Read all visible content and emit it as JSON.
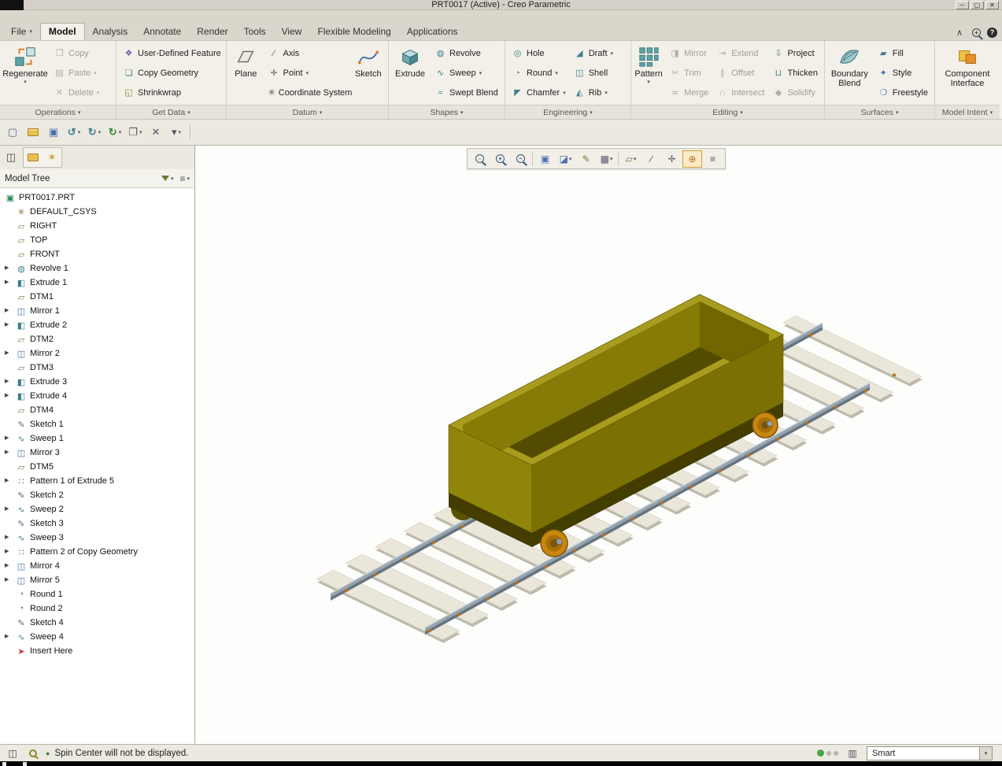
{
  "window": {
    "title": "PRT0017 (Active) - Creo Parametric",
    "buttons": {
      "minimize": "─",
      "maximize": "▢",
      "close": "✕"
    }
  },
  "tabs": {
    "items": [
      {
        "label": "File",
        "dropdown": true
      },
      {
        "label": "Model",
        "state": "active"
      },
      {
        "label": "Analysis"
      },
      {
        "label": "Annotate"
      },
      {
        "label": "Render"
      },
      {
        "label": "Tools"
      },
      {
        "label": "View"
      },
      {
        "label": "Flexible Modeling"
      },
      {
        "label": "Applications"
      }
    ],
    "right_icons": [
      {
        "icon": "minimize-ribbon"
      },
      {
        "icon": "search"
      },
      {
        "icon": "help"
      }
    ]
  },
  "ribbon": {
    "groups": [
      {
        "label": "Operations",
        "big": {
          "label": "Regenerate",
          "icon": "regenerate",
          "dropdown": true
        },
        "items": [
          {
            "label": "Copy",
            "icon": "copy",
            "disabled": true
          },
          {
            "label": "Paste",
            "icon": "paste",
            "disabled": true,
            "dropdown": true
          },
          {
            "label": "Delete",
            "icon": "delete",
            "disabled": true,
            "dropdown": true
          }
        ]
      },
      {
        "label": "Get Data",
        "items": [
          {
            "label": "User-Defined Feature",
            "icon": "udf"
          },
          {
            "label": "Copy Geometry",
            "icon": "copy-geometry"
          },
          {
            "label": "Shrinkwrap",
            "icon": "shrinkwrap"
          }
        ]
      },
      {
        "label": "Datum",
        "big": {
          "label": "Plane",
          "icon": "plane"
        },
        "big2": {
          "label": "Sketch",
          "icon": "sketch"
        },
        "items": [
          {
            "label": "Axis",
            "icon": "axis"
          },
          {
            "label": "Point",
            "icon": "point",
            "dropdown": true
          },
          {
            "label": "Coordinate System",
            "icon": "csys"
          }
        ]
      },
      {
        "label": "Shapes",
        "big": {
          "label": "Extrude",
          "icon": "extrude"
        },
        "items": [
          {
            "label": "Revolve",
            "icon": "revolve"
          },
          {
            "label": "Sweep",
            "icon": "sweep",
            "dropdown": true
          },
          {
            "label": "Swept Blend",
            "icon": "swept-blend"
          }
        ]
      },
      {
        "label": "Engineering",
        "items": [
          {
            "label": "Hole",
            "icon": "hole"
          },
          {
            "label": "Round",
            "icon": "round",
            "dropdown": true
          },
          {
            "label": "Chamfer",
            "icon": "chamfer",
            "dropdown": true
          },
          {
            "label": "Draft",
            "icon": "draft",
            "dropdown": true
          },
          {
            "label": "Shell",
            "icon": "shell"
          },
          {
            "label": "Rib",
            "icon": "rib",
            "dropdown": true
          }
        ]
      },
      {
        "label": "Editing",
        "big": {
          "label": "Pattern",
          "icon": "pattern",
          "dropdown": true
        },
        "items": [
          {
            "label": "Mirror",
            "icon": "mirror",
            "disabled": true
          },
          {
            "label": "Trim",
            "icon": "trim",
            "disabled": true
          },
          {
            "label": "Merge",
            "icon": "merge",
            "disabled": true
          },
          {
            "label": "Extend",
            "icon": "extend",
            "disabled": true
          },
          {
            "label": "Offset",
            "icon": "offset",
            "disabled": true
          },
          {
            "label": "Intersect",
            "icon": "intersect",
            "disabled": true
          },
          {
            "label": "Project",
            "icon": "project"
          },
          {
            "label": "Thicken",
            "icon": "thicken"
          },
          {
            "label": "Solidify",
            "icon": "solidify",
            "disabled": true
          }
        ]
      },
      {
        "label": "Surfaces",
        "big": {
          "label": "Boundary Blend",
          "icon": "boundary-blend"
        },
        "items": [
          {
            "label": "Fill",
            "icon": "fill"
          },
          {
            "label": "Style",
            "icon": "style"
          },
          {
            "label": "Freestyle",
            "icon": "freestyle"
          }
        ]
      },
      {
        "label": "Model Intent",
        "big": {
          "label": "Component Interface",
          "icon": "component-interface"
        }
      }
    ]
  },
  "quick_toolbar": {
    "items": [
      {
        "icon": "new-file"
      },
      {
        "icon": "open-folder"
      },
      {
        "icon": "save"
      },
      {
        "icon": "undo",
        "dropdown": true
      },
      {
        "icon": "redo",
        "dropdown": true
      },
      {
        "icon": "regenerate-small",
        "dropdown": true
      },
      {
        "icon": "window",
        "dropdown": true
      },
      {
        "icon": "close-window"
      },
      {
        "icon": "customize-toolbar",
        "dropdown": true
      }
    ]
  },
  "navigator_toolbar": {
    "items": [
      {
        "icon": "show-navigator"
      },
      {
        "icon": "folder-browser"
      },
      {
        "icon": "favorites"
      }
    ]
  },
  "graphics_toolbar": {
    "items": [
      {
        "icon": "refit"
      },
      {
        "icon": "zoom-in"
      },
      {
        "icon": "zoom-out",
        "sep": true
      },
      {
        "icon": "repaint"
      },
      {
        "icon": "display-style",
        "dropdown": true
      },
      {
        "icon": "annotation-display"
      },
      {
        "icon": "saved-orientations",
        "dropdown": true,
        "sep": true
      },
      {
        "icon": "datum-display",
        "dropdown": true
      },
      {
        "icon": "axis-display"
      },
      {
        "icon": "point-display"
      },
      {
        "icon": "spin-center",
        "state": "active"
      },
      {
        "icon": "view-manager"
      }
    ]
  },
  "model_tree": {
    "title": "Model Tree",
    "items": [
      {
        "label": "PRT0017.PRT",
        "icon": "part",
        "level": "root"
      },
      {
        "label": "DEFAULT_CSYS",
        "icon": "csys"
      },
      {
        "label": "RIGHT",
        "icon": "plane"
      },
      {
        "label": "TOP",
        "icon": "plane"
      },
      {
        "label": "FRONT",
        "icon": "plane"
      },
      {
        "label": "Revolve 1",
        "icon": "revolve",
        "expand": true
      },
      {
        "label": "Extrude 1",
        "icon": "extrude",
        "expand": true
      },
      {
        "label": "DTM1",
        "icon": "plane"
      },
      {
        "label": "Mirror 1",
        "icon": "mirror",
        "expand": true
      },
      {
        "label": "Extrude 2",
        "icon": "extrude",
        "expand": true
      },
      {
        "label": "DTM2",
        "icon": "plane"
      },
      {
        "label": "Mirror 2",
        "icon": "mirror",
        "expand": true
      },
      {
        "label": "DTM3",
        "icon": "plane"
      },
      {
        "label": "Extrude 3",
        "icon": "extrude",
        "expand": true
      },
      {
        "label": "Extrude 4",
        "icon": "extrude",
        "expand": true
      },
      {
        "label": "DTM4",
        "icon": "plane"
      },
      {
        "label": "Sketch 1",
        "icon": "sketch"
      },
      {
        "label": "Sweep 1",
        "icon": "sweep",
        "expand": true
      },
      {
        "label": "Mirror 3",
        "icon": "mirror",
        "expand": true
      },
      {
        "label": "DTM5",
        "icon": "plane"
      },
      {
        "label": "Pattern 1 of Extrude 5",
        "icon": "pattern",
        "expand": true
      },
      {
        "label": "Sketch 2",
        "icon": "sketch"
      },
      {
        "label": "Sweep 2",
        "icon": "sweep",
        "expand": true
      },
      {
        "label": "Sketch 3",
        "icon": "sketch"
      },
      {
        "label": "Sweep 3",
        "icon": "sweep",
        "expand": true
      },
      {
        "label": "Pattern 2 of Copy Geometry",
        "icon": "pattern",
        "expand": true
      },
      {
        "label": "Mirror 4",
        "icon": "mirror",
        "expand": true
      },
      {
        "label": "Mirror 5",
        "icon": "mirror",
        "expand": true
      },
      {
        "label": "Round 1",
        "icon": "round"
      },
      {
        "label": "Round 2",
        "icon": "round"
      },
      {
        "label": "Sketch 4",
        "icon": "sketch"
      },
      {
        "label": "Sweep 4",
        "icon": "sweep",
        "expand": true
      },
      {
        "label": "Insert Here",
        "icon": "insert"
      }
    ]
  },
  "status_bar": {
    "message": "Spin Center will not be displayed.",
    "selection_filter": {
      "label": "Smart"
    }
  },
  "scene": {
    "tie_color": "#eae7da",
    "tie_shadow": "#bdbaab",
    "tie_edge": "#d0cdbf",
    "rail_color": "#96a4af",
    "rail_dark": "#66747f",
    "rail_highlight": "#cfd8de",
    "fastener": "#b5722b",
    "cart_rim": "#a89c1e",
    "cart_interior": "#534c00",
    "cart_inner_far": "#857b06",
    "cart_inner_right": "#6f6600",
    "cart_left": "#90850b",
    "cart_near": "#7b7103",
    "cart_chassis": "#433d00",
    "wheel_color": "#c9870c",
    "wheel_mid": "#a86f08",
    "wheel_hub": "#7a5413",
    "wheel_dark": "#5a5300",
    "wheel_knob": "#9aa2aa"
  }
}
